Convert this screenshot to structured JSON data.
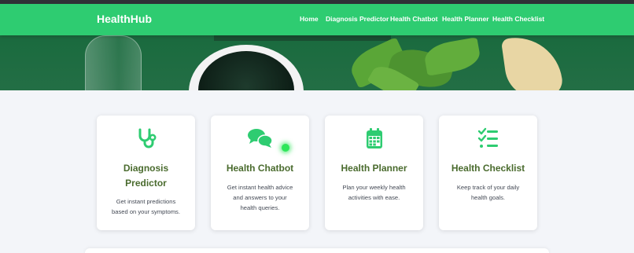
{
  "colors": {
    "navbar": "#2ecc71",
    "accent": "#2ecc71",
    "card_title": "#4a6b2e",
    "page_bg": "#f3f5f9"
  },
  "navbar": {
    "brand": "HealthHub",
    "links": [
      {
        "label": "Home"
      },
      {
        "label": "Diagnosis Predictor"
      },
      {
        "label": "Health Chatbot"
      },
      {
        "label": "Health Planner"
      },
      {
        "label": "Health Checklist"
      }
    ]
  },
  "cards": [
    {
      "icon": "stethoscope-icon",
      "title_line1": "Diagnosis",
      "title_line2": "Predictor",
      "desc_line1": "Get instant predictions",
      "desc_line2": "based on your symptoms."
    },
    {
      "icon": "chat-bubbles-icon",
      "title_line1": "Health Chatbot",
      "desc_line1": "Get instant health advice",
      "desc_line2": "and answers to your",
      "desc_line3": "health queries."
    },
    {
      "icon": "calendar-icon",
      "title_line1": "Health Planner",
      "desc_line1": "Plan your weekly health",
      "desc_line2": "activities with ease."
    },
    {
      "icon": "checklist-icon",
      "title_line1": "Health Checklist",
      "desc_line1": "Keep track of your daily",
      "desc_line2": "health goals."
    }
  ]
}
